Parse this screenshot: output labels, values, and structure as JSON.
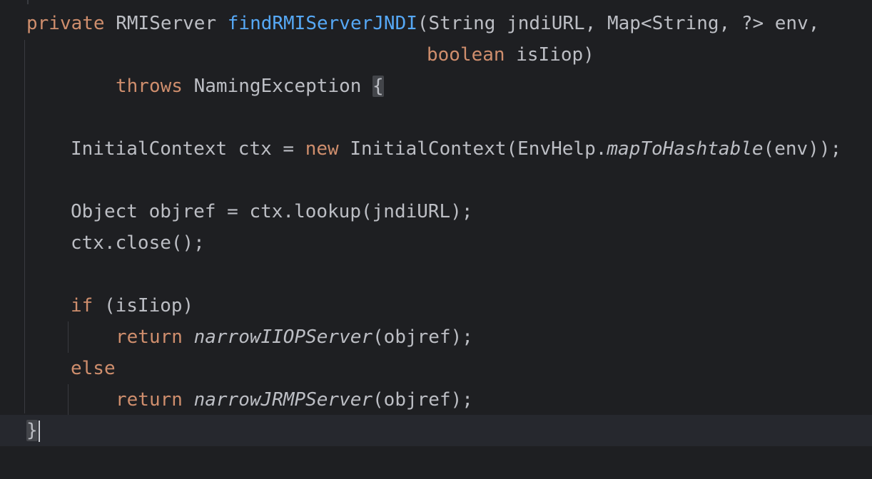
{
  "editor": {
    "lines": [
      {
        "tokens": [
          {
            "t": "private",
            "c": "kw"
          },
          {
            "t": " RMIServer "
          },
          {
            "t": "findRMIServerJNDI",
            "c": "fn"
          },
          {
            "t": "(String jndiURL, Map<String, ?> env,"
          }
        ]
      },
      {
        "tokens": [
          {
            "t": "boolean",
            "c": "kw"
          },
          {
            "t": " isIiop)"
          }
        ]
      },
      {
        "tokens": [
          {
            "t": "throws",
            "c": "kw"
          },
          {
            "t": " NamingException "
          },
          {
            "t": "{",
            "c": "brace"
          }
        ]
      },
      {
        "tokens": []
      },
      {
        "tokens": [
          {
            "t": "InitialContext ctx = "
          },
          {
            "t": "new",
            "c": "kw"
          },
          {
            "t": " InitialContext(EnvHelp."
          },
          {
            "t": "mapToHashtable",
            "c": "it"
          },
          {
            "t": "(env));"
          }
        ]
      },
      {
        "tokens": []
      },
      {
        "tokens": [
          {
            "t": "Object objref = ctx.lookup(jndiURL);"
          }
        ]
      },
      {
        "tokens": [
          {
            "t": "ctx.close();"
          }
        ]
      },
      {
        "tokens": []
      },
      {
        "tokens": [
          {
            "t": "if",
            "c": "kw"
          },
          {
            "t": " (isIiop)"
          }
        ]
      },
      {
        "tokens": [
          {
            "t": "return",
            "c": "kw"
          },
          {
            "t": " "
          },
          {
            "t": "narrowIIOPServer",
            "c": "it"
          },
          {
            "t": "(objref);"
          }
        ]
      },
      {
        "tokens": [
          {
            "t": "else",
            "c": "kw"
          }
        ]
      },
      {
        "tokens": [
          {
            "t": "return",
            "c": "kw"
          },
          {
            "t": " "
          },
          {
            "t": "narrowJRMPServer",
            "c": "it"
          },
          {
            "t": "(objref);"
          }
        ]
      },
      {
        "tokens": [
          {
            "t": "}",
            "c": "brace"
          }
        ]
      }
    ],
    "current_line": 14,
    "colors": {
      "background": "#1e1f22",
      "current_line": "#26282e",
      "text": "#bcbec4",
      "keyword": "#cf8e6d",
      "method_declaration": "#56a8f5",
      "brace_highlight": "#43454a",
      "indent_guide": "#393b40"
    }
  }
}
